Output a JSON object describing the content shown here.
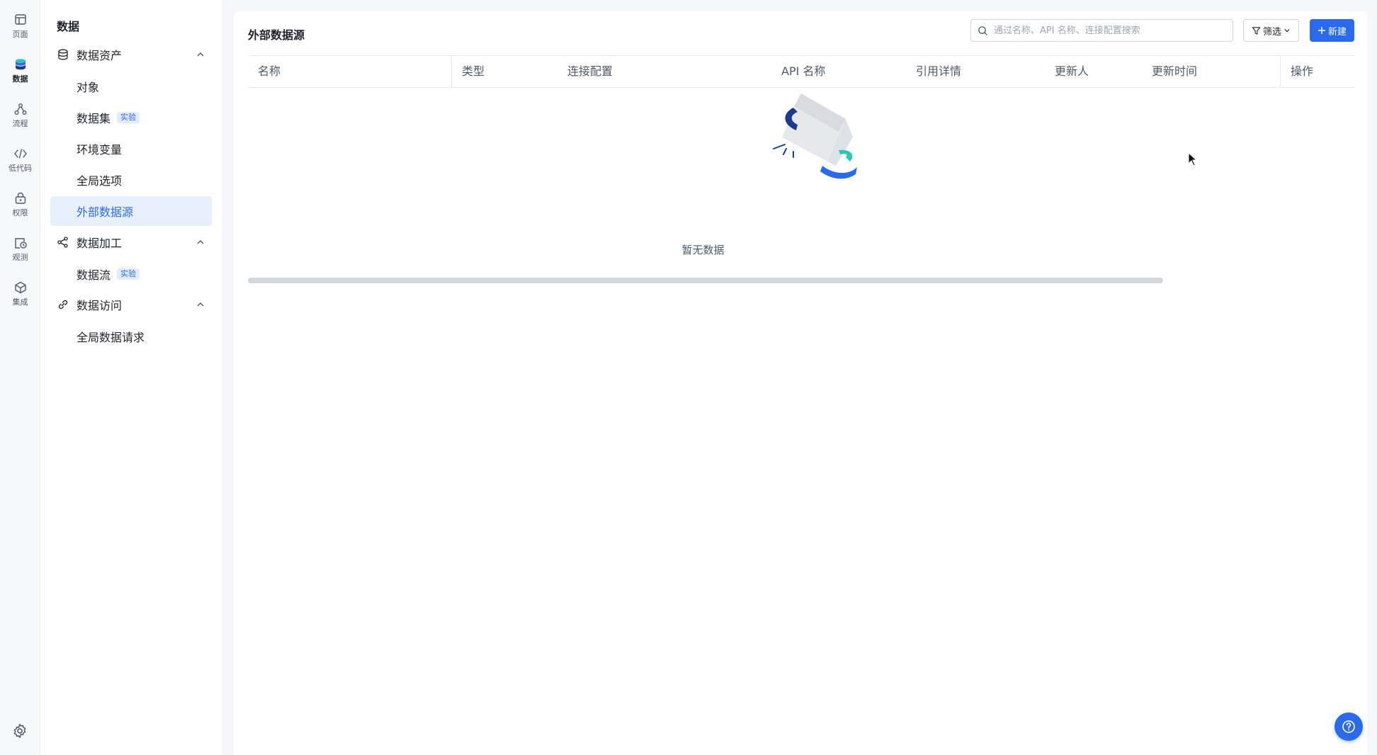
{
  "rail": {
    "items": [
      {
        "label": "页面",
        "icon": "page-icon"
      },
      {
        "label": "数据",
        "icon": "database-icon",
        "active": true
      },
      {
        "label": "流程",
        "icon": "flow-icon"
      },
      {
        "label": "低代码",
        "icon": "code-icon"
      },
      {
        "label": "权限",
        "icon": "lock-icon"
      },
      {
        "label": "观测",
        "icon": "monitor-icon"
      },
      {
        "label": "集成",
        "icon": "cube-icon"
      }
    ],
    "settings_icon": "gear-icon"
  },
  "nav": {
    "title": "数据",
    "groups": [
      {
        "label": "数据资产",
        "icon": "database-icon",
        "items": [
          {
            "label": "对象"
          },
          {
            "label": "数据集",
            "badge": "实验"
          },
          {
            "label": "环境变量"
          },
          {
            "label": "全局选项"
          },
          {
            "label": "外部数据源",
            "active": true
          }
        ]
      },
      {
        "label": "数据加工",
        "icon": "share-nodes-icon",
        "items": [
          {
            "label": "数据流",
            "badge": "实验"
          }
        ]
      },
      {
        "label": "数据访问",
        "icon": "link-icon",
        "items": [
          {
            "label": "全局数据请求"
          }
        ]
      }
    ]
  },
  "main": {
    "title": "外部数据源",
    "search_placeholder": "通过名称、API 名称、连接配置搜索",
    "filter_label": "筛选",
    "new_label": "新建",
    "columns": [
      "名称",
      "类型",
      "连接配置",
      "API 名称",
      "引用详情",
      "更新人",
      "更新时间",
      "操作"
    ],
    "rows": [],
    "empty_text": "暂无数据"
  },
  "colors": {
    "accent": "#2b6aea",
    "active_bg": "#e8effd",
    "teal": "#2ec7b3",
    "navy": "#1e3a8a"
  }
}
